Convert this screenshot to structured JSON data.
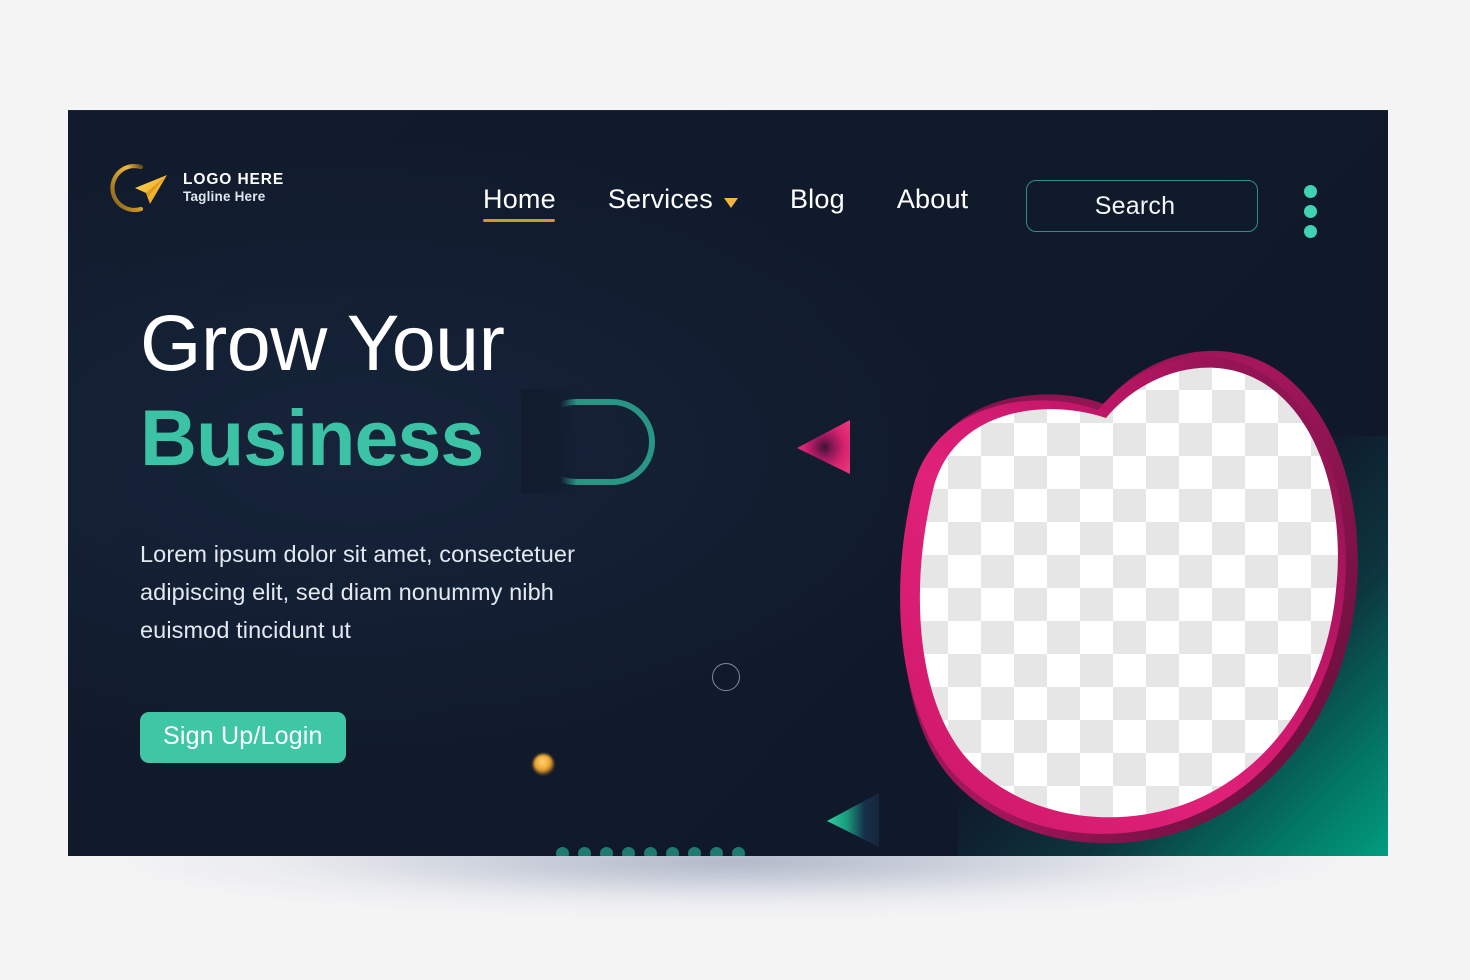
{
  "brand": {
    "logo_title": "LOGO HERE",
    "logo_tagline": "Tagline Here",
    "logo_icon": "paper-plane-icon"
  },
  "nav": {
    "items": [
      {
        "label": "Home",
        "active": true,
        "has_caret": false
      },
      {
        "label": "Services",
        "active": false,
        "has_caret": true
      },
      {
        "label": "Blog",
        "active": false,
        "has_caret": false
      },
      {
        "label": "About",
        "active": false,
        "has_caret": false
      }
    ]
  },
  "search": {
    "label": "Search",
    "placeholder": "Search"
  },
  "more_menu": {
    "icon": "kebab-menu-icon",
    "dots": 3
  },
  "hero": {
    "headline_line1": "Grow Your",
    "headline_line2": "Business",
    "paragraph": "Lorem ipsum dolor sit amet, consectetuer adipiscing elit, sed diam nonummy nibh euismod tincidunt ut",
    "cta_label": "Sign Up/Login"
  },
  "decor": {
    "triangle_pink": "play-triangle-icon",
    "triangle_teal": "play-triangle-icon",
    "ring_large": "circle-outline-icon",
    "ring_small": "circle-outline-icon",
    "glow_dot": "glow-dot-icon",
    "dot_grid_rows": 2,
    "dot_grid_columns": 9,
    "image_placeholder": "blob-image-placeholder"
  },
  "colors": {
    "card_background": "#111b2d",
    "accent_teal": "#3fc6a5",
    "accent_teal_dark": "#2aa08c",
    "accent_pink": "#e01a6f",
    "accent_pink_dark": "#a01a5c",
    "accent_gold": "#f4b63f",
    "accent_gold_dark": "#c99a2e",
    "text_primary": "#ffffff",
    "text_secondary": "#e3e9f1",
    "page_background": "#f4f4f5",
    "corner_glow": "#00a383"
  }
}
